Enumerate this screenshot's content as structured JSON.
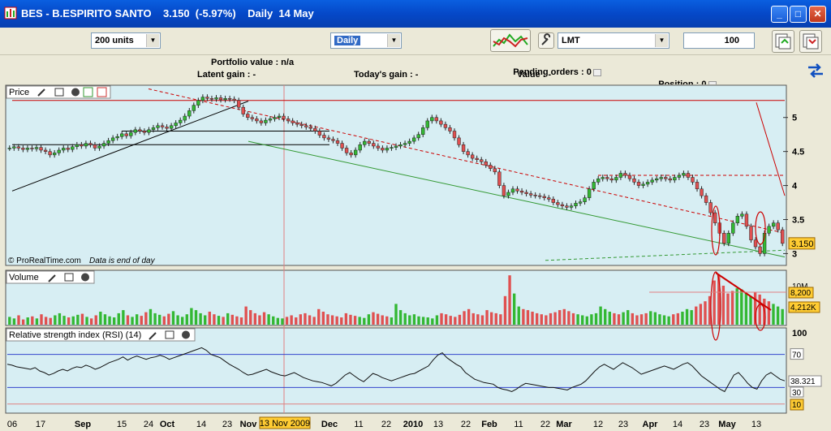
{
  "window": {
    "title": "BES - B.ESPIRITO SANTO    3.150  (-5.97%)    Daily  14 May",
    "minimize": "_",
    "maximize": "□",
    "close": "✕"
  },
  "toolbar": {
    "units_value": "200 units",
    "period_value": "Daily",
    "order_type_value": "LMT",
    "quantity_value": "100"
  },
  "portfolio": {
    "portfolio_value": "Portfolio value : n/a",
    "latent_gain": "Latent gain : -",
    "todays_gain": "Today's gain : -",
    "pending_orders": "Pending orders : 0",
    "value": "Value : -",
    "position": "Position : 0"
  },
  "panels": {
    "price_title": "Price",
    "volume_title": "Volume",
    "rsi_title": "Relative strength index (RSI) (14)",
    "copyright": "© ProRealTime.com",
    "data_end_note": "Data is end of day"
  },
  "chart_data": {
    "type": "candlestick",
    "x_labels": [
      "06",
      "17",
      "Sep",
      "15",
      "24",
      "Oct",
      "14",
      "23",
      "Nov",
      "Dec",
      "11",
      "22",
      "2010",
      "13",
      "22",
      "Feb",
      "11",
      "22",
      "Mar",
      "12",
      "23",
      "Apr",
      "14",
      "23",
      "May",
      "13"
    ],
    "crosshair_date": "13 Nov 2009",
    "price": {
      "y_ticks": [
        "5",
        "4.5",
        "4",
        "3.5",
        "3"
      ],
      "ylim": [
        2.85,
        5.45
      ],
      "last_price": "3.150",
      "series": [
        4.55,
        4.57,
        4.55,
        4.53,
        4.55,
        4.54,
        4.56,
        4.52,
        4.5,
        4.45,
        4.48,
        4.52,
        4.55,
        4.53,
        4.57,
        4.6,
        4.58,
        4.62,
        4.6,
        4.55,
        4.58,
        4.62,
        4.66,
        4.7,
        4.72,
        4.76,
        4.73,
        4.78,
        4.82,
        4.8,
        4.78,
        4.82,
        4.85,
        4.88,
        4.86,
        4.84,
        4.88,
        4.92,
        4.96,
        5.02,
        5.1,
        5.18,
        5.25,
        5.3,
        5.28,
        5.27,
        5.29,
        5.26,
        5.28,
        5.27,
        5.25,
        5.15,
        5.05,
        5.0,
        4.98,
        4.95,
        4.92,
        4.96,
        4.98,
        5.0,
        5.02,
        4.98,
        4.95,
        4.92,
        4.9,
        4.88,
        4.86,
        4.84,
        4.8,
        4.74,
        4.7,
        4.68,
        4.66,
        4.62,
        4.55,
        4.48,
        4.45,
        4.52,
        4.6,
        4.65,
        4.62,
        4.58,
        4.55,
        4.52,
        4.55,
        4.56,
        4.58,
        4.6,
        4.62,
        4.65,
        4.7,
        4.75,
        4.85,
        4.95,
        5.0,
        4.95,
        4.9,
        4.85,
        4.8,
        4.7,
        4.6,
        4.5,
        4.45,
        4.4,
        4.38,
        4.35,
        4.3,
        4.25,
        4.2,
        4.0,
        3.85,
        3.9,
        3.95,
        3.92,
        3.9,
        3.88,
        3.86,
        3.85,
        3.84,
        3.82,
        3.8,
        3.75,
        3.72,
        3.7,
        3.68,
        3.7,
        3.74,
        3.76,
        3.82,
        3.95,
        4.05,
        4.1,
        4.12,
        4.1,
        4.08,
        4.12,
        4.18,
        4.15,
        4.1,
        4.05,
        4.0,
        4.02,
        4.05,
        4.08,
        4.1,
        4.12,
        4.1,
        4.08,
        4.12,
        4.15,
        4.18,
        4.12,
        4.05,
        3.95,
        3.85,
        3.75,
        3.6,
        3.45,
        3.3,
        3.15,
        3.3,
        3.45,
        3.55,
        3.58,
        3.4,
        3.2,
        3.1,
        3.0,
        3.3,
        3.4,
        3.45,
        3.35,
        3.15
      ],
      "lines": [
        {
          "color": "#000000",
          "style": "solid",
          "from": [
            "06",
            3.92
          ],
          "to": [
            "Nov",
            5.24
          ]
        },
        {
          "color": "#000000",
          "style": "solid",
          "from": [
            "15",
            4.8
          ],
          "to": [
            "Dec",
            4.8
          ]
        },
        {
          "color": "#000000",
          "style": "solid",
          "from": [
            "06",
            4.6
          ],
          "to": [
            "Dec",
            4.6
          ]
        },
        {
          "color": "#cc0000",
          "style": "solid",
          "from": [
            "06",
            5.25
          ],
          "to": [
            "13",
            5.25
          ]
        },
        {
          "color": "#cc0000",
          "style": "solid",
          "from": [
            "13",
            5.22
          ],
          "to": [
            "13",
            3.85
          ]
        },
        {
          "color": "#cc0000",
          "style": "dashed",
          "from": [
            "24",
            5.42
          ],
          "to": [
            "13",
            3.3
          ]
        },
        {
          "color": "#cc0000",
          "style": "dashed",
          "from": [
            "12",
            4.15
          ],
          "to": [
            "13",
            4.15
          ]
        },
        {
          "color": "#339933",
          "style": "solid",
          "from": [
            "Nov",
            4.65
          ],
          "to": [
            "13",
            2.95
          ]
        },
        {
          "color": "#339933",
          "style": "dashed",
          "from": [
            "22",
            2.9
          ],
          "to": [
            "13",
            3.05
          ]
        }
      ]
    },
    "volume": {
      "labels": [
        "10M",
        "8,200",
        "4,212K"
      ],
      "series": [
        0.15,
        0.12,
        0.18,
        0.1,
        0.14,
        0.16,
        0.12,
        0.2,
        0.15,
        0.13,
        0.18,
        0.22,
        0.17,
        0.14,
        0.16,
        0.19,
        0.21,
        0.15,
        0.12,
        0.18,
        0.25,
        0.2,
        0.16,
        0.14,
        0.22,
        0.28,
        0.18,
        0.15,
        0.2,
        0.17,
        0.24,
        0.3,
        0.22,
        0.19,
        0.16,
        0.21,
        0.26,
        0.18,
        0.15,
        0.2,
        0.32,
        0.28,
        0.22,
        0.18,
        0.25,
        0.2,
        0.17,
        0.15,
        0.22,
        0.19,
        0.16,
        0.14,
        0.35,
        0.28,
        0.22,
        0.18,
        0.24,
        0.2,
        0.16,
        0.13,
        0.12,
        0.15,
        0.18,
        0.14,
        0.2,
        0.22,
        0.18,
        0.15,
        0.3,
        0.25,
        0.2,
        0.18,
        0.16,
        0.14,
        0.22,
        0.19,
        0.17,
        0.15,
        0.13,
        0.2,
        0.24,
        0.21,
        0.18,
        0.16,
        0.14,
        0.4,
        0.28,
        0.22,
        0.18,
        0.2,
        0.16,
        0.15,
        0.14,
        0.12,
        0.18,
        0.22,
        0.2,
        0.17,
        0.15,
        0.19,
        0.26,
        0.3,
        0.22,
        0.2,
        0.18,
        0.28,
        0.24,
        0.22,
        0.2,
        0.55,
        0.95,
        0.6,
        0.35,
        0.3,
        0.28,
        0.25,
        0.22,
        0.2,
        0.18,
        0.22,
        0.24,
        0.28,
        0.3,
        0.26,
        0.22,
        0.2,
        0.18,
        0.16,
        0.2,
        0.22,
        0.35,
        0.3,
        0.25,
        0.22,
        0.2,
        0.24,
        0.28,
        0.22,
        0.18,
        0.2,
        0.22,
        0.26,
        0.24,
        0.2,
        0.18,
        0.16,
        0.2,
        0.22,
        0.25,
        0.3,
        0.28,
        0.35,
        0.4,
        0.45,
        0.55,
        0.85,
        0.95,
        0.75,
        0.6,
        0.65,
        0.7,
        0.68,
        0.6,
        0.55,
        0.62,
        0.58,
        0.5,
        0.45,
        0.4,
        0.35,
        0.3
      ],
      "down_days_red": true
    },
    "rsi": {
      "labels": [
        "100",
        "70",
        "38.321",
        "30",
        "10"
      ],
      "overbought": 70,
      "oversold": 30,
      "series": [
        58,
        57,
        55,
        54,
        53,
        52,
        54,
        50,
        48,
        45,
        47,
        50,
        52,
        50,
        53,
        55,
        54,
        57,
        55,
        52,
        54,
        57,
        60,
        62,
        64,
        67,
        63,
        66,
        68,
        66,
        64,
        66,
        67,
        69,
        67,
        64,
        66,
        68,
        70,
        72,
        74,
        76,
        78,
        75,
        70,
        68,
        66,
        62,
        58,
        55,
        52,
        48,
        45,
        46,
        48,
        50,
        52,
        49,
        47,
        45,
        44,
        46,
        48,
        45,
        42,
        40,
        38,
        37,
        36,
        34,
        32,
        35,
        40,
        45,
        48,
        44,
        40,
        37,
        42,
        47,
        45,
        42,
        40,
        38,
        40,
        42,
        44,
        46,
        47,
        50,
        53,
        56,
        63,
        69,
        72,
        66,
        62,
        58,
        55,
        48,
        44,
        40,
        38,
        36,
        35,
        34,
        30,
        28,
        27,
        25,
        28,
        32,
        35,
        34,
        33,
        32,
        31,
        30,
        30,
        29,
        28,
        27,
        30,
        32,
        34,
        38,
        44,
        50,
        55,
        58,
        55,
        52,
        56,
        60,
        57,
        54,
        50,
        46,
        48,
        50,
        52,
        54,
        56,
        54,
        52,
        55,
        58,
        60,
        56,
        50,
        44,
        40,
        36,
        32,
        28,
        25,
        35,
        45,
        48,
        42,
        35,
        30,
        28,
        38,
        45,
        48,
        44,
        40,
        38
      ]
    }
  },
  "colors": {
    "chart_bg": "#d7eef3",
    "up_candle": "#33b833",
    "down_candle": "#e05050",
    "annotation_red": "#cc0000",
    "annotation_green": "#339933",
    "price_tag_bg": "#ffcc33"
  }
}
